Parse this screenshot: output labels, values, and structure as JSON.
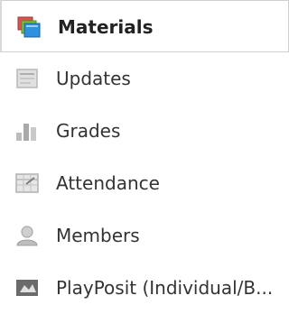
{
  "nav": {
    "items": [
      {
        "label": "Materials",
        "icon": "materials-icon",
        "active": true
      },
      {
        "label": "Updates",
        "icon": "updates-icon",
        "active": false
      },
      {
        "label": "Grades",
        "icon": "grades-icon",
        "active": false
      },
      {
        "label": "Attendance",
        "icon": "attendance-icon",
        "active": false
      },
      {
        "label": "Members",
        "icon": "members-icon",
        "active": false
      },
      {
        "label": "PlayPosit (Individual/B...",
        "icon": "playposit-icon",
        "active": false
      }
    ]
  },
  "colors": {
    "active_border": "#cfcfcf",
    "text": "#333333",
    "icon_gray": "#b0b0b0",
    "materials_blue": "#2f8fe0",
    "materials_red": "#d9534f"
  }
}
